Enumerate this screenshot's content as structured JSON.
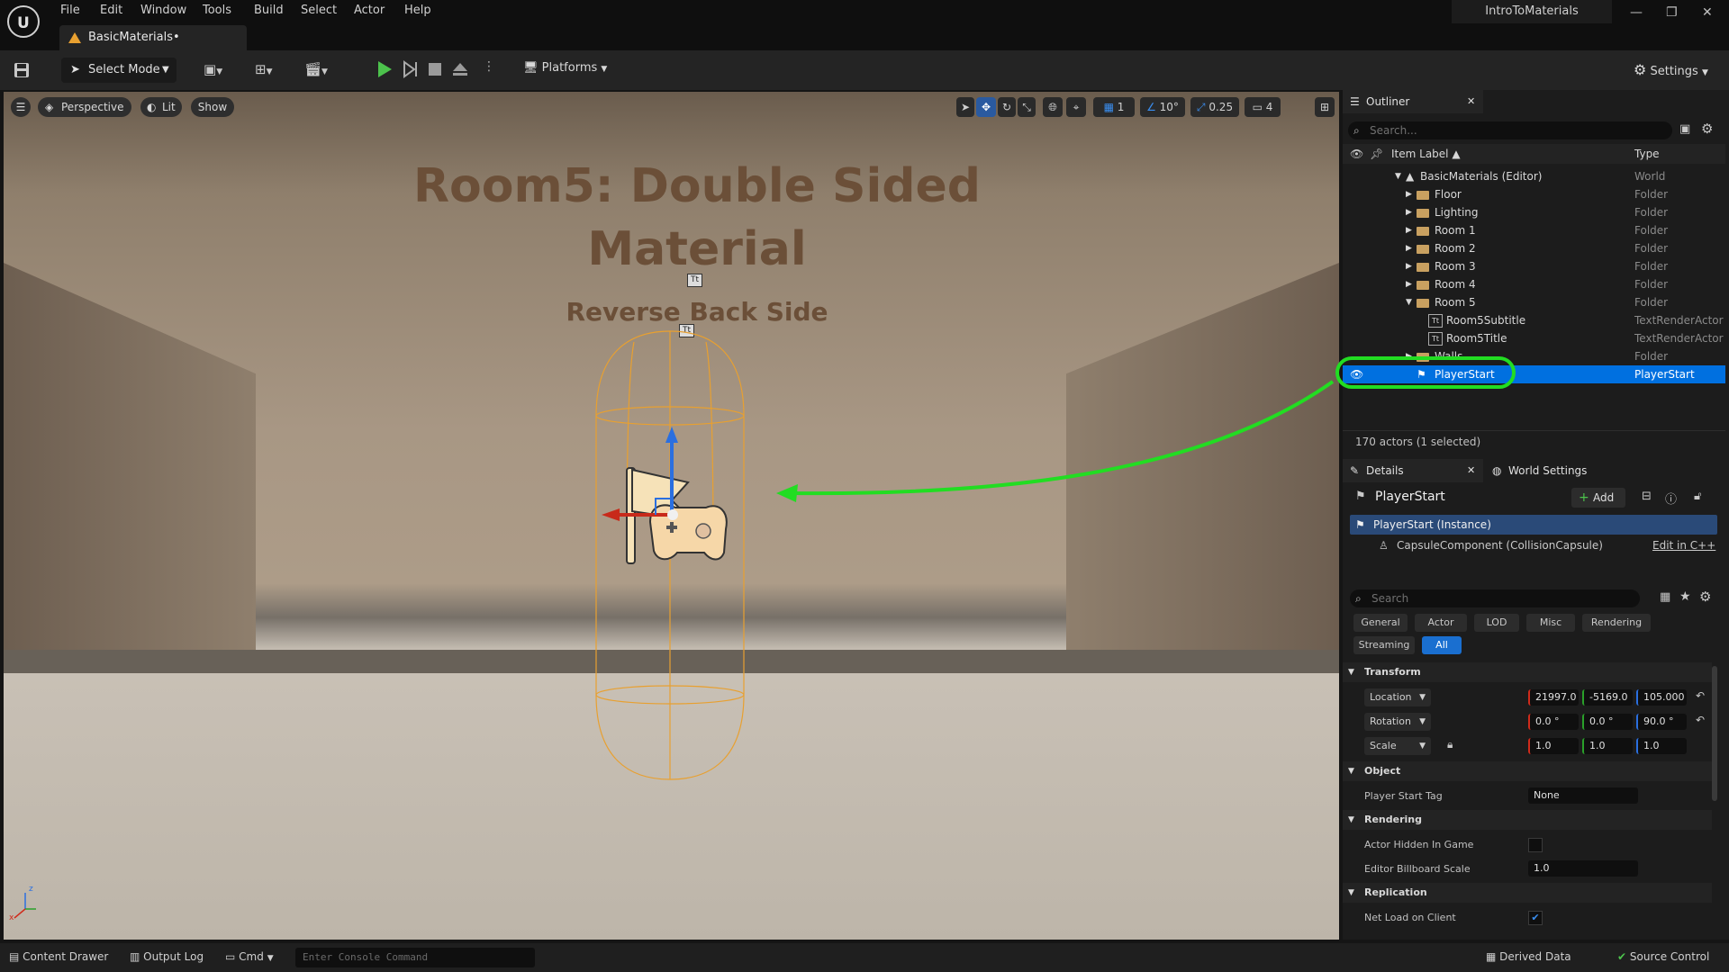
{
  "menu": {
    "items": [
      "File",
      "Edit",
      "Window",
      "Tools",
      "Build",
      "Select",
      "Actor",
      "Help"
    ]
  },
  "document_tab": {
    "label": "BasicMaterials•"
  },
  "project_name": "IntroToMaterials",
  "toolbar": {
    "select_mode": "Select Mode",
    "platforms": "Platforms",
    "settings": "Settings"
  },
  "viewport": {
    "perspective": "Perspective",
    "lit": "Lit",
    "show": "Show",
    "grid_size": "1",
    "rotation_snap": "10°",
    "scale_snap": "0.25",
    "camera_speed": "4",
    "title_line1": "Room5: Double Sided",
    "title_line2": "Material",
    "subtitle": "Reverse Back Side",
    "text_icon": "Tt"
  },
  "outliner": {
    "tab": "Outliner",
    "search_placeholder": "Search...",
    "col_label": "Item Label",
    "col_type": "Type",
    "rows": [
      {
        "label": "BasicMaterials (Editor)",
        "type": "World"
      },
      {
        "label": "Floor",
        "type": "Folder"
      },
      {
        "label": "Lighting",
        "type": "Folder"
      },
      {
        "label": "Room 1",
        "type": "Folder"
      },
      {
        "label": "Room 2",
        "type": "Folder"
      },
      {
        "label": "Room 3",
        "type": "Folder"
      },
      {
        "label": "Room 4",
        "type": "Folder"
      },
      {
        "label": "Room 5",
        "type": "Folder"
      },
      {
        "label": "Room5Subtitle",
        "type": "TextRenderActor"
      },
      {
        "label": "Room5Title",
        "type": "TextRenderActor"
      },
      {
        "label": "Walls",
        "type": "Folder"
      },
      {
        "label": "PlayerStart",
        "type": "PlayerStart"
      }
    ],
    "status": "170 actors (1 selected)"
  },
  "details": {
    "tab": "Details",
    "world_settings_tab": "World Settings",
    "actor_name": "PlayerStart",
    "add_label": "Add",
    "instance": "PlayerStart (Instance)",
    "component": "CapsuleComponent (CollisionCapsule)",
    "edit_cpp": "Edit in C++",
    "search_placeholder": "Search",
    "categories": [
      "General",
      "Actor",
      "LOD",
      "Misc",
      "Rendering",
      "Streaming",
      "All"
    ],
    "transform": {
      "header": "Transform",
      "location_label": "Location",
      "location": [
        "21997.0",
        "-5169.0",
        "105.000"
      ],
      "rotation_label": "Rotation",
      "rotation": [
        "0.0 °",
        "0.0 °",
        "90.0 °"
      ],
      "scale_label": "Scale",
      "scale": [
        "1.0",
        "1.0",
        "1.0"
      ]
    },
    "object": {
      "header": "Object",
      "tag_label": "Player Start Tag",
      "tag_value": "None"
    },
    "rendering": {
      "header": "Rendering",
      "hidden_label": "Actor Hidden In Game",
      "billboard_label": "Editor Billboard Scale",
      "billboard_value": "1.0"
    },
    "replication": {
      "header": "Replication",
      "net_load_label": "Net Load on Client"
    }
  },
  "statusbar": {
    "content_drawer": "Content Drawer",
    "output_log": "Output Log",
    "cmd": "Cmd",
    "console_placeholder": "Enter Console Command",
    "derived_data": "Derived Data",
    "source_control": "Source Control"
  },
  "colors": {
    "selection": "#0070e0",
    "annotation_green": "#22dd22",
    "accent_blue": "#1a6fd0"
  }
}
